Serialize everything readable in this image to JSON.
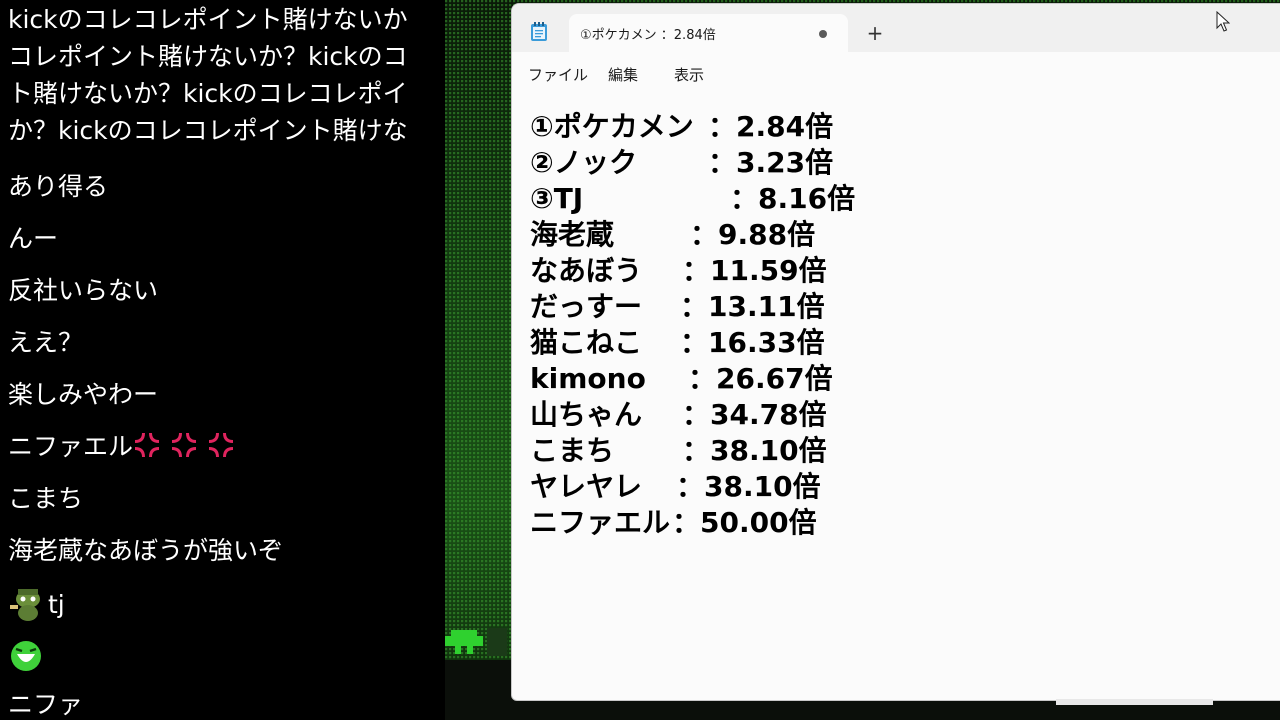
{
  "chat": {
    "long_message": [
      "kickのコレコレポイント賭けないか",
      "コレポイント賭けないか？kickのコ",
      "ト賭けないか？kickのコレコレポイ",
      "か？kickのコレコレポイント賭けな"
    ],
    "messages": [
      "あり得る",
      "んー",
      "反社いらない",
      "ええ？",
      "楽しみやわー",
      "ニファエル",
      "こまち",
      "海老蔵なあぼうが強いぞ",
      "tj",
      "",
      "ニファ"
    ]
  },
  "notepad": {
    "tab_title": "①ポケカメン ：2.84倍",
    "new_tab_label": "+",
    "menu": [
      "ファイル",
      "編集",
      "表示"
    ],
    "lines": [
      {
        "name": "①ポケカメン",
        "odds": "：2.84倍"
      },
      {
        "name": "②ノック",
        "odds": "：3.23倍"
      },
      {
        "name": "③TJ",
        "odds": "：8.16倍"
      },
      {
        "name": "海老蔵",
        "odds": "：9.88倍"
      },
      {
        "name": "なあぼう",
        "odds": "：11.59倍"
      },
      {
        "name": "だっすー",
        "odds": "：13.11倍"
      },
      {
        "name": "猫こねこ",
        "odds": "：16.33倍"
      },
      {
        "name": "kimono",
        "odds": "：26.67倍"
      },
      {
        "name": "山ちゃん",
        "odds": "：34.78倍"
      },
      {
        "name": "こまち",
        "odds": "：38.10倍"
      },
      {
        "name": "ヤレヤレ",
        "odds": "：38.10倍"
      },
      {
        "name": "ニファエル",
        "odds": "：50.00倍"
      }
    ]
  },
  "colors": {
    "chat_bg": "#000000",
    "chat_text": "#ffffff",
    "anger_emoji": "#e0245e",
    "notepad_bg": "#fbfbfb",
    "game_green": "#1a5216"
  },
  "icons": {
    "anger": "anger-symbol-icon",
    "app": "notepad-app-icon",
    "cursor": "mouse-pointer-icon"
  }
}
